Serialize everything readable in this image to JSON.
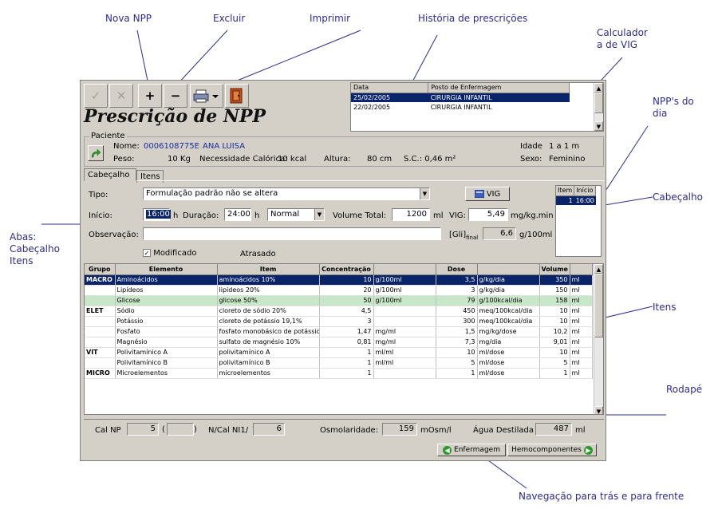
{
  "annotations": {
    "nova_npp": "Nova NPP",
    "excluir": "Excluir",
    "imprimir": "Imprimir",
    "historia": "História de prescrições",
    "calculadora_line1": "Calculador",
    "calculadora_line2": "a de VIG",
    "npps_line1": "NPP's do",
    "npps_line2": "dia",
    "cabecalho": "Cabeçalho",
    "abas_line1": "Abas:",
    "abas_line2": "Cabeçalho",
    "abas_line3": "Itens",
    "itens": "Itens",
    "rodape": "Rodapé",
    "navegacao": "Navegação para trás e para frente"
  },
  "toolbar": {
    "check": "✓",
    "cancel": "✕",
    "plus": "+",
    "minus": "−"
  },
  "window_title": "Prescrição de NPP",
  "history": {
    "col_data": "Data",
    "col_posto": "Posto de Enfermagem",
    "rows": [
      {
        "data": "25/02/2005",
        "posto": "CIRURGIA INFANTIL"
      },
      {
        "data": "22/02/2005",
        "posto": "CIRURGIA INFANTIL"
      }
    ]
  },
  "paciente": {
    "legend": "Paciente",
    "nome_label": "Nome:",
    "nome_id": "0006108775E",
    "nome": "ANA LUISA",
    "peso_label": "Peso:",
    "peso": "10 Kg",
    "nec_label": "Necessidade Calórica:",
    "nec": "10 kcal",
    "altura_label": "Altura:",
    "altura": "80 cm",
    "sc": "S.C.: 0,46 m²",
    "idade_label": "Idade",
    "idade": "1 a 1 m",
    "sexo_label": "Sexo:",
    "sexo": "Feminino"
  },
  "tabs": [
    "Cabeçalho",
    "Itens"
  ],
  "header": {
    "tipo_label": "Tipo:",
    "tipo_value": "Formulação padrão não se altera",
    "vig_button": "VIG",
    "inicio_label": "Início:",
    "inicio_value": "16:00",
    "h": "h",
    "duracao_label": "Duração:",
    "duracao_value": "24:00",
    "modo_value": "Normal",
    "volume_label": "Volume Total:",
    "volume_value": "1200",
    "ml": "ml",
    "vig_label": "VIG:",
    "vig_value": "5,49",
    "vig_unit": "mg/kg.min",
    "obs_label": "Observação:",
    "obs_value": "",
    "gli_label": "[Gli]",
    "gli_sub": "final",
    "gli_value": "6,6",
    "gli_unit": "g/100ml",
    "modificado": "Modificado",
    "atrasado": "Atrasado"
  },
  "npp_dia": {
    "col_item": "Item",
    "col_inicio": "Início",
    "rows": [
      {
        "item": "1",
        "inicio": "16:00"
      }
    ]
  },
  "grid": {
    "columns": [
      "Grupo",
      "Elemento",
      "Item",
      "Concentração",
      "",
      "Dose",
      "",
      "Volume",
      ""
    ],
    "rows": [
      {
        "grupo": "MACRO",
        "elemento": "Aminoácidos",
        "item": "aminoácidos 10%",
        "conc": "10",
        "conc_unit": "g/100ml",
        "dose": "3,5",
        "dose_unit": "g/kg/dia",
        "vol": "350",
        "vol_unit": "ml",
        "style": "sel"
      },
      {
        "grupo": "",
        "elemento": "Lipídeos",
        "item": "lipídeos 20%",
        "conc": "20",
        "conc_unit": "g/100ml",
        "dose": "3",
        "dose_unit": "g/kg/dia",
        "vol": "150",
        "vol_unit": "ml",
        "style": ""
      },
      {
        "grupo": "",
        "elemento": "Glicose",
        "item": "glicose 50%",
        "conc": "50",
        "conc_unit": "g/100ml",
        "dose": "79",
        "dose_unit": "g/100kcal/dia",
        "vol": "158",
        "vol_unit": "ml",
        "style": "green"
      },
      {
        "grupo": "ELET",
        "elemento": "Sódio",
        "item": "cloreto de sódio 20%",
        "conc": "4,5",
        "conc_unit": "",
        "dose": "450",
        "dose_unit": "meq/100kcal/dia",
        "vol": "10",
        "vol_unit": "ml",
        "style": "sep"
      },
      {
        "grupo": "",
        "elemento": "Potássio",
        "item": "cloreto de potássio 19,1%",
        "conc": "3",
        "conc_unit": "",
        "dose": "300",
        "dose_unit": "meq/100kcal/dia",
        "vol": "10",
        "vol_unit": "ml",
        "style": ""
      },
      {
        "grupo": "",
        "elemento": "Fosfato",
        "item": "fosfato monobásico de potássio",
        "conc": "1,47",
        "conc_unit": "mg/ml",
        "dose": "1,5",
        "dose_unit": "mg/kg/dose",
        "vol": "10,2",
        "vol_unit": "ml",
        "style": ""
      },
      {
        "grupo": "",
        "elemento": "Magnésio",
        "item": "sulfato de magnésio 10%",
        "conc": "0,81",
        "conc_unit": "mg/ml",
        "dose": "7,3",
        "dose_unit": "mg/dia",
        "vol": "9,01",
        "vol_unit": "ml",
        "style": ""
      },
      {
        "grupo": "VIT",
        "elemento": "Polivitamínico A",
        "item": "polivitamínico A",
        "conc": "1",
        "conc_unit": "ml/ml",
        "dose": "10",
        "dose_unit": "ml/dose",
        "vol": "10",
        "vol_unit": "ml",
        "style": "sep"
      },
      {
        "grupo": "",
        "elemento": "Polivitamínico B",
        "item": "polivitamínico B",
        "conc": "1",
        "conc_unit": "ml/ml",
        "dose": "5",
        "dose_unit": "ml/dose",
        "vol": "5",
        "vol_unit": "ml",
        "style": ""
      },
      {
        "grupo": "MICRO",
        "elemento": "Microelementos",
        "item": "microelementos",
        "conc": "1",
        "conc_unit": "",
        "dose": "1",
        "dose_unit": "ml/dose",
        "vol": "1",
        "vol_unit": "ml",
        "style": "sep"
      }
    ]
  },
  "footer": {
    "calnp_label": "Cal NP",
    "calnp_value": "5",
    "paren_open": "(",
    "paren_close": ")",
    "paren_value": "",
    "ncal_label": "N/Cal NI1/",
    "ncal_value": "6",
    "osm_label": "Osmolaridade:",
    "osm_value": "159",
    "osm_unit": "mOsm/l",
    "agua_label": "Água Destilada",
    "agua_value": "487",
    "ml": "ml"
  },
  "nav": {
    "back": "Enfermagem",
    "forward": "Hemocomponentes"
  }
}
